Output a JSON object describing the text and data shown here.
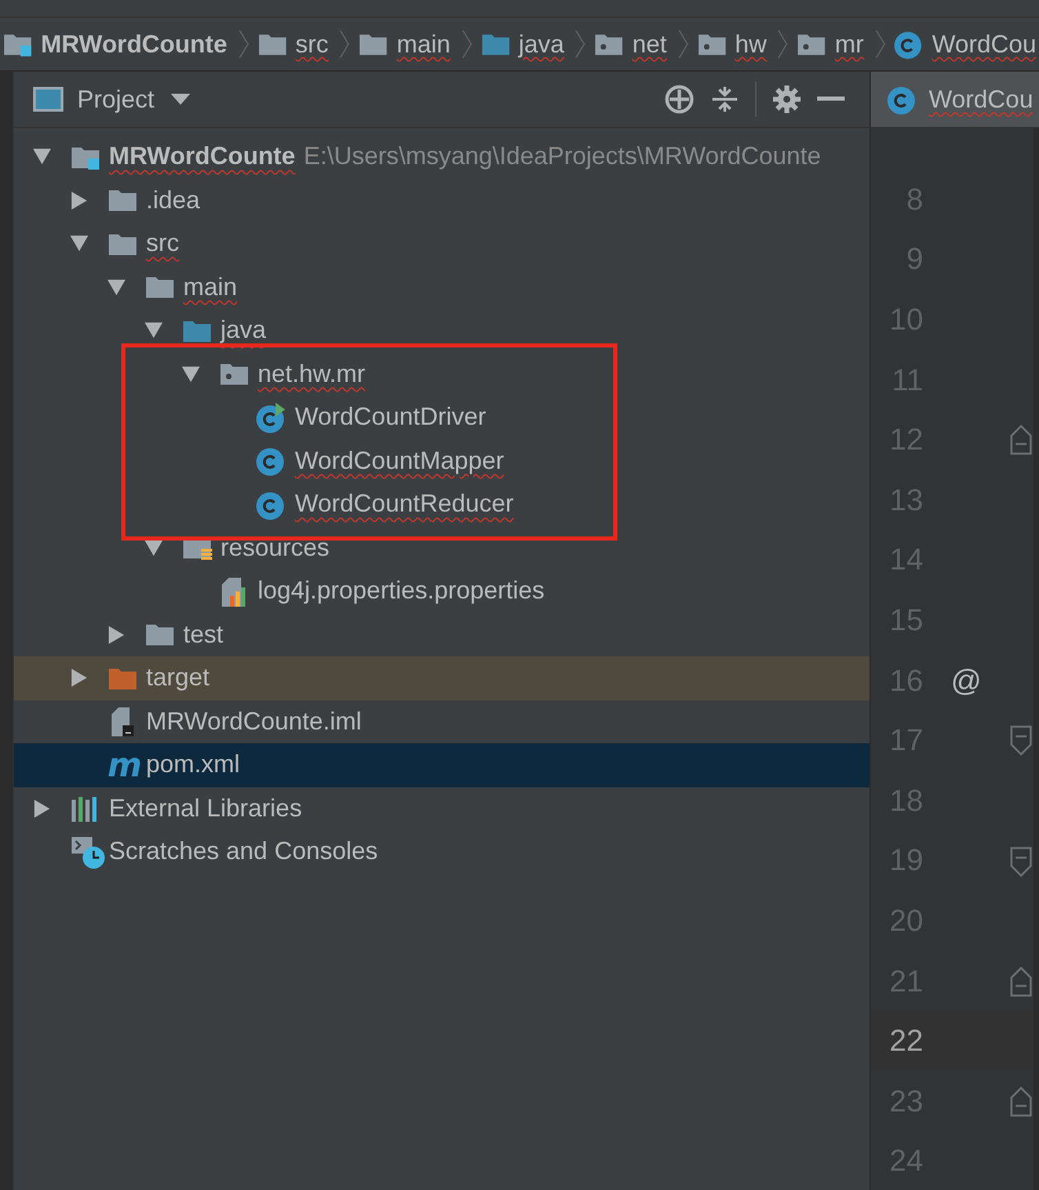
{
  "breadcrumbs": [
    {
      "label": "MRWordCounte",
      "kind": "module",
      "misspelled": false
    },
    {
      "label": "src",
      "kind": "folder",
      "misspelled": true
    },
    {
      "label": "main",
      "kind": "folder",
      "misspelled": true
    },
    {
      "label": "java",
      "kind": "source",
      "misspelled": true
    },
    {
      "label": "net",
      "kind": "package",
      "misspelled": true
    },
    {
      "label": "hw",
      "kind": "package",
      "misspelled": true
    },
    {
      "label": "mr",
      "kind": "package",
      "misspelled": true
    },
    {
      "label": "WordCou",
      "kind": "class",
      "misspelled": true
    }
  ],
  "project_panel": {
    "title": "Project"
  },
  "tree": [
    {
      "label": "MRWordCounte",
      "path": "E:\\Users\\msyang\\IdeaProjects\\MRWordCounte",
      "kind": "module",
      "expanded": true,
      "selected": false,
      "excluded": false,
      "misspelled": true,
      "children": [
        {
          "label": ".idea",
          "kind": "folder",
          "expanded": false,
          "selected": false,
          "excluded": false,
          "misspelled": false
        },
        {
          "label": "src",
          "kind": "folder",
          "expanded": true,
          "selected": false,
          "excluded": false,
          "misspelled": true,
          "children": [
            {
              "label": "main",
              "kind": "folder",
              "expanded": true,
              "selected": false,
              "excluded": false,
              "misspelled": true,
              "children": [
                {
                  "label": "java",
                  "kind": "source",
                  "expanded": true,
                  "selected": false,
                  "excluded": false,
                  "misspelled": true,
                  "children": [
                    {
                      "label": "net.hw.mr",
                      "kind": "package",
                      "expanded": true,
                      "selected": false,
                      "excluded": false,
                      "misspelled": true,
                      "children": [
                        {
                          "label": "WordCountDriver",
                          "kind": "runnable-class",
                          "selected": false,
                          "excluded": false,
                          "misspelled": false
                        },
                        {
                          "label": "WordCountMapper",
                          "kind": "class",
                          "selected": false,
                          "excluded": false,
                          "misspelled": true
                        },
                        {
                          "label": "WordCountReducer",
                          "kind": "class",
                          "selected": false,
                          "excluded": false,
                          "misspelled": true
                        }
                      ]
                    }
                  ]
                },
                {
                  "label": "resources",
                  "kind": "resources",
                  "expanded": true,
                  "selected": false,
                  "excluded": false,
                  "misspelled": false,
                  "children": [
                    {
                      "label": "log4j.properties.properties",
                      "kind": "properties",
                      "selected": false,
                      "excluded": false,
                      "misspelled": false
                    }
                  ]
                }
              ]
            },
            {
              "label": "test",
              "kind": "folder",
              "expanded": false,
              "selected": false,
              "excluded": false,
              "misspelled": false
            }
          ]
        },
        {
          "label": "target",
          "kind": "excluded-folder",
          "expanded": false,
          "selected": false,
          "excluded": true,
          "misspelled": false
        },
        {
          "label": "MRWordCounte.iml",
          "kind": "iml",
          "selected": false,
          "excluded": false,
          "misspelled": false
        },
        {
          "label": "pom.xml",
          "kind": "maven",
          "icon_text": "m",
          "selected": true,
          "excluded": false,
          "misspelled": false
        }
      ]
    },
    {
      "label": "External Libraries",
      "kind": "libraries",
      "expanded": false,
      "selected": false,
      "excluded": false,
      "misspelled": false
    },
    {
      "label": "Scratches and Consoles",
      "kind": "scratches",
      "selected": false,
      "excluded": false,
      "misspelled": false
    }
  ],
  "editor": {
    "tab": {
      "label": "WordCou",
      "misspelled": true
    },
    "lines": [
      {
        "number": "8",
        "current": false,
        "kind": "plain"
      },
      {
        "number": "9",
        "current": false,
        "kind": "plain"
      },
      {
        "number": "10",
        "current": false,
        "kind": "plain"
      },
      {
        "number": "11",
        "current": false,
        "kind": "plain"
      },
      {
        "number": "12",
        "current": false,
        "kind": "fold-end"
      },
      {
        "number": "13",
        "current": false,
        "kind": "plain"
      },
      {
        "number": "14",
        "current": false,
        "kind": "plain"
      },
      {
        "number": "15",
        "current": false,
        "kind": "plain"
      },
      {
        "number": "16",
        "current": false,
        "kind": "plain",
        "marker": "@"
      },
      {
        "number": "17",
        "current": false,
        "kind": "fold-start"
      },
      {
        "number": "18",
        "current": false,
        "kind": "plain"
      },
      {
        "number": "19",
        "current": false,
        "kind": "fold-start"
      },
      {
        "number": "20",
        "current": false,
        "kind": "plain"
      },
      {
        "number": "21",
        "current": false,
        "kind": "fold-end"
      },
      {
        "number": "22",
        "current": true,
        "kind": "plain"
      },
      {
        "number": "23",
        "current": false,
        "kind": "fold-end"
      },
      {
        "number": "24",
        "current": false,
        "kind": "plain"
      }
    ]
  },
  "annotation": {
    "kind": "frame",
    "color": "#e8281c"
  }
}
